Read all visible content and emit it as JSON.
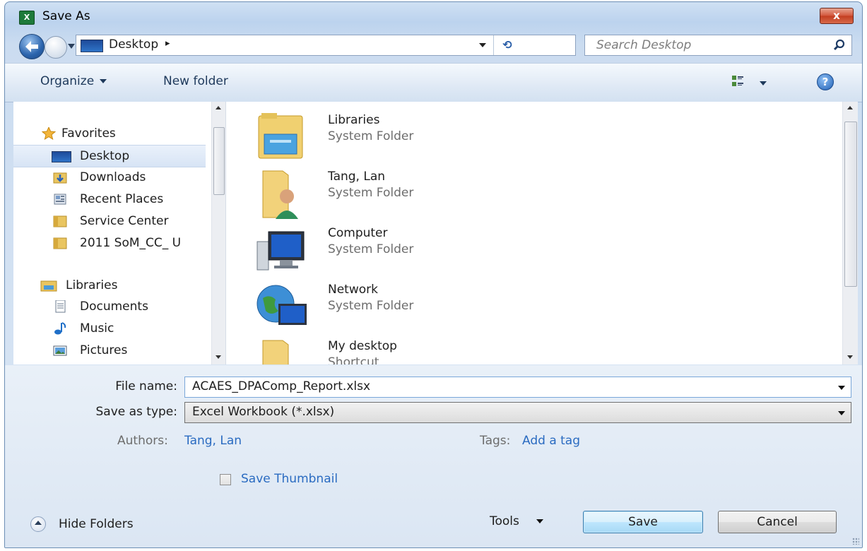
{
  "window": {
    "title": "Save As",
    "close_label": "x",
    "app_icon": "excel-icon"
  },
  "address": {
    "location": "Desktop",
    "separator": "▸",
    "refresh_symbol": "⟲"
  },
  "search": {
    "placeholder": "Search Desktop"
  },
  "toolbar": {
    "organize_label": "Organize",
    "new_folder_label": "New folder",
    "help_label": "?"
  },
  "nav": {
    "favorites_header": "Favorites",
    "favorites": [
      {
        "label": "Desktop",
        "icon": "desktop-icon",
        "selected": true
      },
      {
        "label": "Downloads",
        "icon": "downloads-icon"
      },
      {
        "label": "Recent Places",
        "icon": "recent-places-icon"
      },
      {
        "label": "Service Center",
        "icon": "folder-icon"
      },
      {
        "label": "2011 SoM_CC_ U",
        "icon": "folder-icon"
      }
    ],
    "libraries_header": "Libraries",
    "libraries": [
      {
        "label": "Documents",
        "icon": "documents-icon"
      },
      {
        "label": "Music",
        "icon": "music-icon"
      },
      {
        "label": "Pictures",
        "icon": "pictures-icon"
      }
    ]
  },
  "files": [
    {
      "name": "Libraries",
      "type": "System Folder",
      "icon": "libraries-icon"
    },
    {
      "name": "Tang, Lan",
      "type": "System Folder",
      "icon": "user-folder-icon"
    },
    {
      "name": "Computer",
      "type": "System Folder",
      "icon": "computer-icon"
    },
    {
      "name": "Network",
      "type": "System Folder",
      "icon": "network-icon"
    },
    {
      "name": "My desktop",
      "type": "Shortcut",
      "icon": "folder-shortcut-icon"
    }
  ],
  "form": {
    "file_name_label": "File name:",
    "file_name_value": "ACAES_DPAComp_Report.xlsx",
    "save_type_label": "Save as type:",
    "save_type_value": "Excel Workbook (*.xlsx)",
    "authors_label": "Authors:",
    "authors_value": "Tang, Lan",
    "tags_label": "Tags:",
    "tags_value": "Add a tag",
    "thumbnail_label": "Save Thumbnail",
    "thumbnail_checked": false
  },
  "footer": {
    "hide_folders_label": "Hide Folders",
    "tools_label": "Tools",
    "save_label": "Save",
    "cancel_label": "Cancel"
  },
  "colors": {
    "accent": "#2a6bc1",
    "selection": "#d7e4f5"
  }
}
